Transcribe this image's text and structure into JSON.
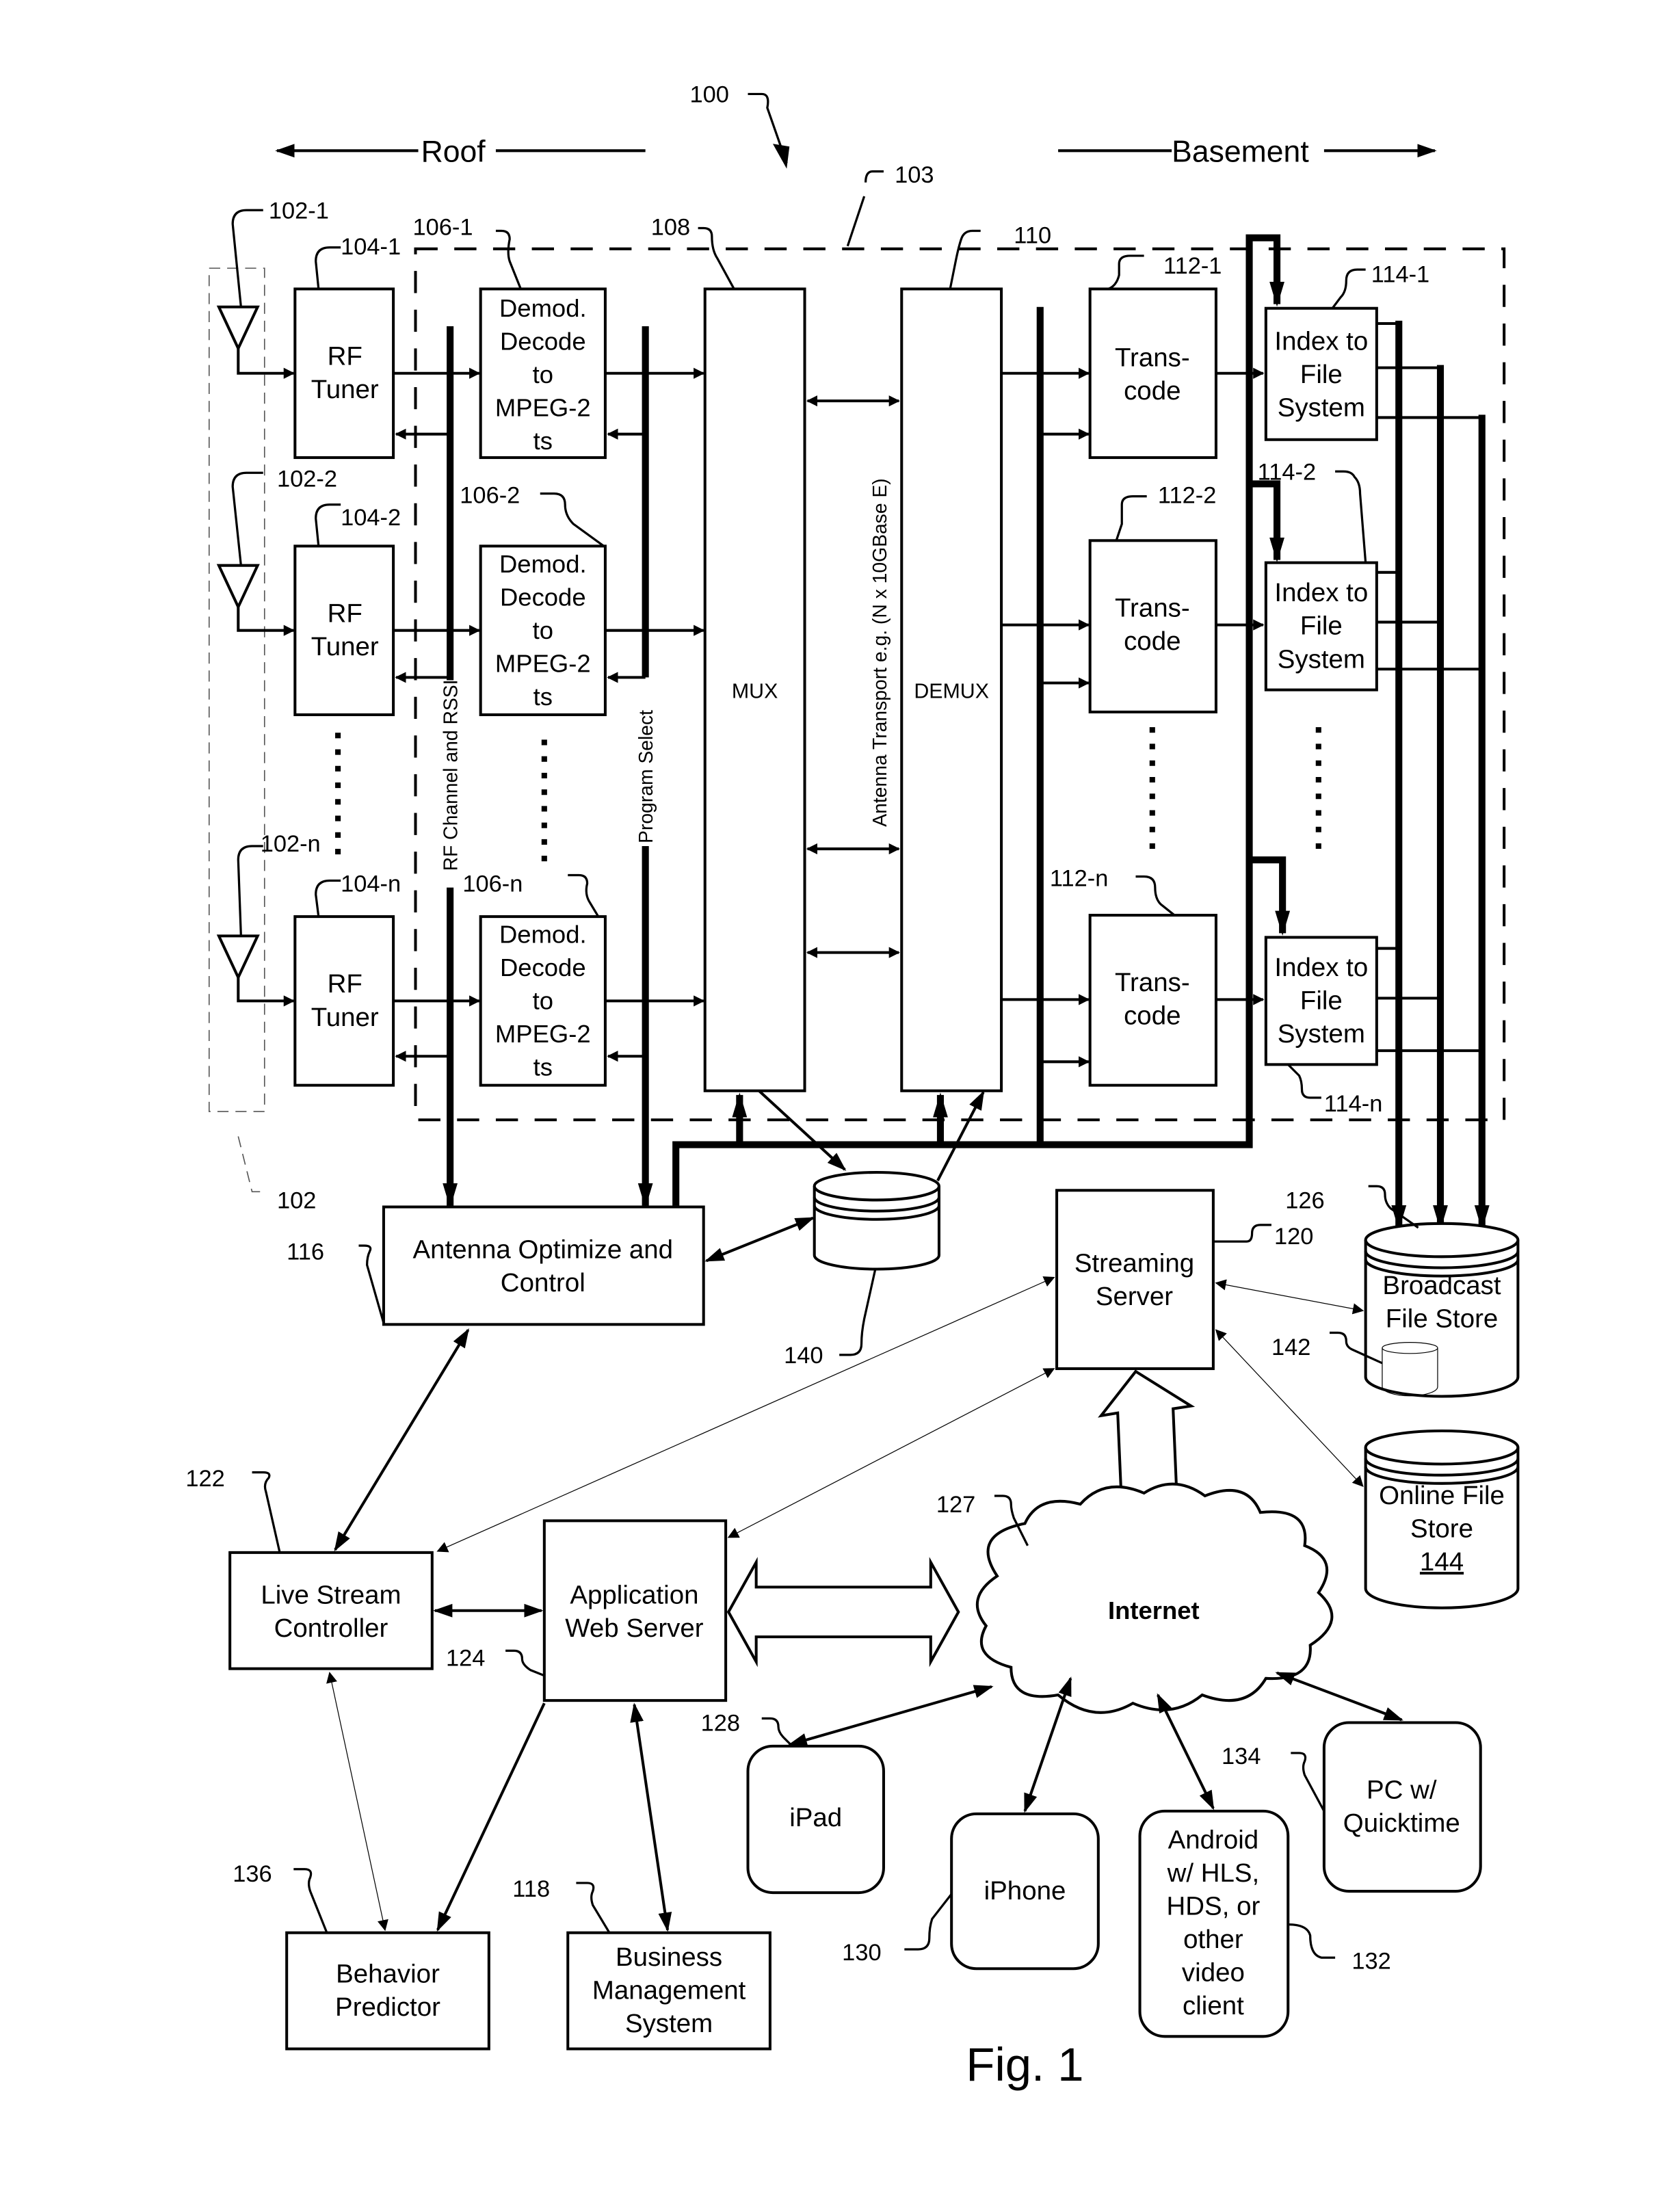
{
  "figure": {
    "caption": "Fig. 1",
    "ref_system": "100",
    "ref_enclosure": "103",
    "direction_left": "Roof",
    "direction_right": "Basement"
  },
  "antenna_array": {
    "ref": "102",
    "antennas": [
      {
        "ref": "102-1"
      },
      {
        "ref": "102-2"
      },
      {
        "ref": "102-n"
      }
    ]
  },
  "rf_tuners": [
    {
      "ref": "104-1",
      "line1": "RF",
      "line2": "Tuner"
    },
    {
      "ref": "104-2",
      "line1": "RF",
      "line2": "Tuner"
    },
    {
      "ref": "104-n",
      "line1": "RF",
      "line2": "Tuner"
    }
  ],
  "demod_blocks": [
    {
      "ref": "106-1",
      "lines": [
        "Demod.",
        "Decode",
        "to",
        "MPEG-2",
        "ts"
      ]
    },
    {
      "ref": "106-2",
      "lines": [
        "Demod.",
        "Decode",
        "to",
        "MPEG-2",
        "ts"
      ]
    },
    {
      "ref": "106-n",
      "lines": [
        "Demod.",
        "Decode",
        "to",
        "MPEG-2",
        "ts"
      ]
    }
  ],
  "buses": {
    "rf_channel": "RF Channel and RSSI",
    "program_select": "Program Select",
    "antenna_transport": "Antenna Transport e.g. (N x 10GBase E)"
  },
  "mux": {
    "ref": "108",
    "label": "MUX"
  },
  "demux": {
    "ref": "110",
    "label": "DEMUX"
  },
  "transcoders": [
    {
      "ref": "112-1",
      "line1": "Trans-",
      "line2": "code"
    },
    {
      "ref": "112-2",
      "line1": "Trans-",
      "line2": "code"
    },
    {
      "ref": "112-n",
      "line1": "Trans-",
      "line2": "code"
    }
  ],
  "indexers": [
    {
      "ref": "114-1",
      "lines": [
        "Index to",
        "File",
        "System"
      ]
    },
    {
      "ref": "114-2",
      "lines": [
        "Index to",
        "File",
        "System"
      ]
    },
    {
      "ref": "114-n",
      "lines": [
        "Index to",
        "File",
        "System"
      ]
    }
  ],
  "antenna_control": {
    "ref": "116",
    "line1": "Antenna Optimize and",
    "line2": "Control"
  },
  "database": {
    "ref": "140"
  },
  "streaming_server": {
    "ref": "120",
    "line1": "Streaming",
    "line2": "Server"
  },
  "broadcast_store": {
    "ref": "126",
    "line1": "Broadcast",
    "line2": "File Store",
    "inner_ref": "142"
  },
  "online_store": {
    "line1": "Online File",
    "line2": "Store",
    "ref": "144"
  },
  "internet": {
    "ref": "127",
    "label": "Internet"
  },
  "live_stream_controller": {
    "ref": "122",
    "line1": "Live Stream",
    "line2": "Controller"
  },
  "app_web_server": {
    "ref": "124",
    "line1": "Application",
    "line2": "Web Server"
  },
  "behavior_predictor": {
    "ref": "136",
    "line1": "Behavior",
    "line2": "Predictor"
  },
  "business_mgmt": {
    "ref": "118",
    "lines": [
      "Business",
      "Management",
      "System"
    ]
  },
  "clients": [
    {
      "ref": "128",
      "lines": [
        "iPad"
      ]
    },
    {
      "ref": "130",
      "lines": [
        "iPhone"
      ]
    },
    {
      "ref": "132",
      "lines": [
        "Android",
        "w/ HLS,",
        "HDS, or",
        "other",
        "video",
        "client"
      ]
    },
    {
      "ref": "134",
      "lines": [
        "PC w/",
        "Quicktime"
      ]
    }
  ]
}
